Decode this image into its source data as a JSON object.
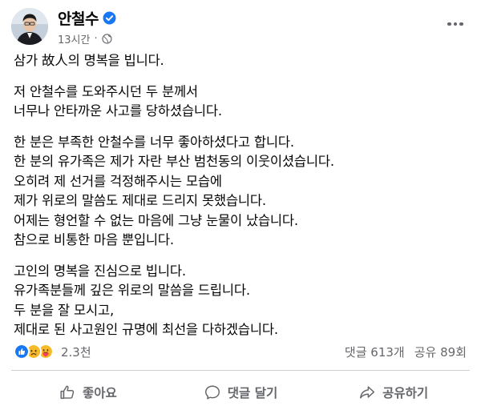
{
  "post": {
    "author": "안철수",
    "time": "13시간",
    "meta_separator": "·",
    "privacy_icon": "globe-icon",
    "verified_icon": "verified-badge-icon",
    "paragraphs": [
      [
        "삼가 故人의 명복을 빕니다."
      ],
      [
        "저 안철수를 도와주시던 두 분께서",
        "너무나 안타까운 사고를 당하셨습니다."
      ],
      [
        "한 분은 부족한 안철수를 너무 좋아하셨다고 합니다.",
        "한 분의 유가족은 제가 자란 부산 범천동의 이웃이셨습니다.",
        "오히려 제 선거를 걱정해주시는 모습에",
        "제가 위로의 말씀도 제대로 드리지 못했습니다.",
        "어제는 형언할 수 없는 마음에 그냥 눈물이 났습니다.",
        "참으로 비통한 마음 뿐입니다."
      ],
      [
        "고인의 명복을 진심으로 빕니다.",
        "유가족분들께 깊은 위로의 말씀을 드립니다.",
        "두 분을 잘 모시고,",
        "제대로 된 사고원인 규명에 최선을 다하겠습니다."
      ]
    ]
  },
  "reactions": {
    "icons": [
      "like-reaction-icon",
      "sad-reaction-icon",
      "care-reaction-icon"
    ],
    "count": "2.3천",
    "comments": "댓글 613개",
    "shares": "공유 89회"
  },
  "actions": {
    "like": "좋아요",
    "comment": "댓글 달기",
    "share": "공유하기"
  },
  "colors": {
    "like_blue": "#1877f2",
    "reaction_yellow": "#f7b928",
    "secondary_text": "#65676b",
    "divider": "#ced0d4"
  }
}
